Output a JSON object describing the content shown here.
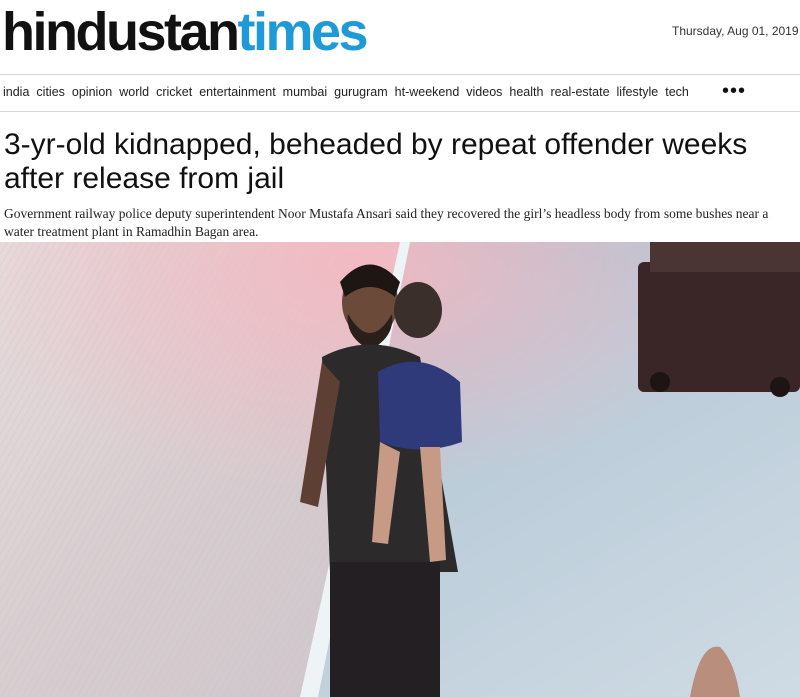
{
  "masthead": {
    "logo_part1": "hindustan",
    "logo_part2": "times",
    "date": "Thursday, Aug 01, 2019"
  },
  "nav": {
    "items": [
      "india",
      "cities",
      "opinion",
      "world",
      "cricket",
      "entertainment",
      "mumbai",
      "gurugram",
      "ht-weekend",
      "videos",
      "health",
      "real-estate",
      "lifestyle",
      "tech"
    ],
    "more_label": "•••"
  },
  "article": {
    "headline": "3-yr-old kidnapped, beheaded by repeat offender weeks after release from jail",
    "summary": "Government railway police deputy superintendent Noor Mustafa Ansari said they recovered the girl’s headless body from some bushes near a water treatment plant in Ramadhin Bagan area."
  },
  "colors": {
    "logo_dark": "#111111",
    "logo_accent": "#1f9ad8"
  },
  "icons": {
    "more": "more-dots-icon"
  }
}
